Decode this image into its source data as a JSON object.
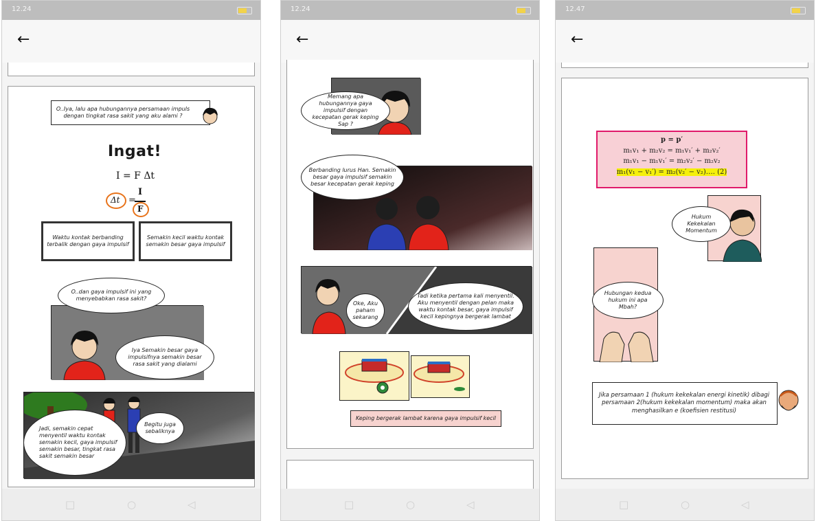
{
  "status": {
    "time": "12.24"
  },
  "nav": {
    "back_label": "←",
    "square_label": "□",
    "home_label": "○",
    "back_nav_label": "◁"
  },
  "screens": [
    {
      "caption_question": "O..Iya, lalu apa hubungannya persamaan impuls dengan tingkat rasa sakit yang aku alami ?",
      "ingat_title": "Ingat!",
      "formula_main": "I = F Δt",
      "formula_dt": "Δt",
      "formula_eq": "=",
      "formula_num": "I",
      "formula_den": "F",
      "box_left": "Waktu kontak berbanding terbalik dengan gaya impulsif",
      "box_right": "Semakin kecil waktu kontak semakin besar gaya impulsif",
      "bubble_1": "O..dan gaya impulsif ini yang menyebabkan rasa sakit?",
      "bubble_2": "Iya Semakin besar gaya impulsifnya semakin besar rasa sakit yang dialami",
      "bubble_3": "Jadi, semakin cepat menyentil waktu kontak semakin kecil, gaya impulsif semakin besar, tingkat rasa sakit semakin besar",
      "bubble_4": "Begitu juga sebaliknya"
    },
    {
      "bubble_1": "Memang apa hubungannya gaya impulsif dengan kecepatan gerak keping Sap ?",
      "bubble_2": "Berbanding lurus Han. Semakin besar gaya impulsif semakin besar kecepatan gerak keping",
      "bubble_3": "Oke, Aku paham sekarang",
      "bubble_4": "Tadi ketika pertama kali menyentil. Aku menyentil dengan pelan maka waktu kontak besar, gaya impulsif kecil kepingnya bergerak lambat",
      "caption": "Keping bergerak lambat karena gaya impulsif kecil"
    },
    {
      "time": "12.47",
      "eq_1": "p = p′",
      "eq_2": "m₁v₁ + m₂v₂ = m₁v₁′ + m₂v₂′",
      "eq_3": "m₁v₁ − m₁v₁′ = m₂v₂′ − m₂v₂",
      "eq_4": "m₁(v₁ − v₁′) = m₂(v₂′ − v₂)…. (2)",
      "bubble_1": "Hukum Kekekalan Momentum",
      "bubble_2": "Hubungan kedua hukum ini apa Mbah?",
      "caption": "Jika persamaan 1 (hukum kekekalan energi kinetik) dibagi persamaan 2(hukum kekekalan momentum) maka akan menghasilkan e (koefisien restitusi)"
    }
  ],
  "colors": {
    "shirt_red": "#e2231a",
    "shirt_blue": "#2b3fb3",
    "eq_border": "#e0196a",
    "eq_fill": "#f8d0d6",
    "highlight": "#f5f00a",
    "orange_circle": "#e8731a"
  }
}
